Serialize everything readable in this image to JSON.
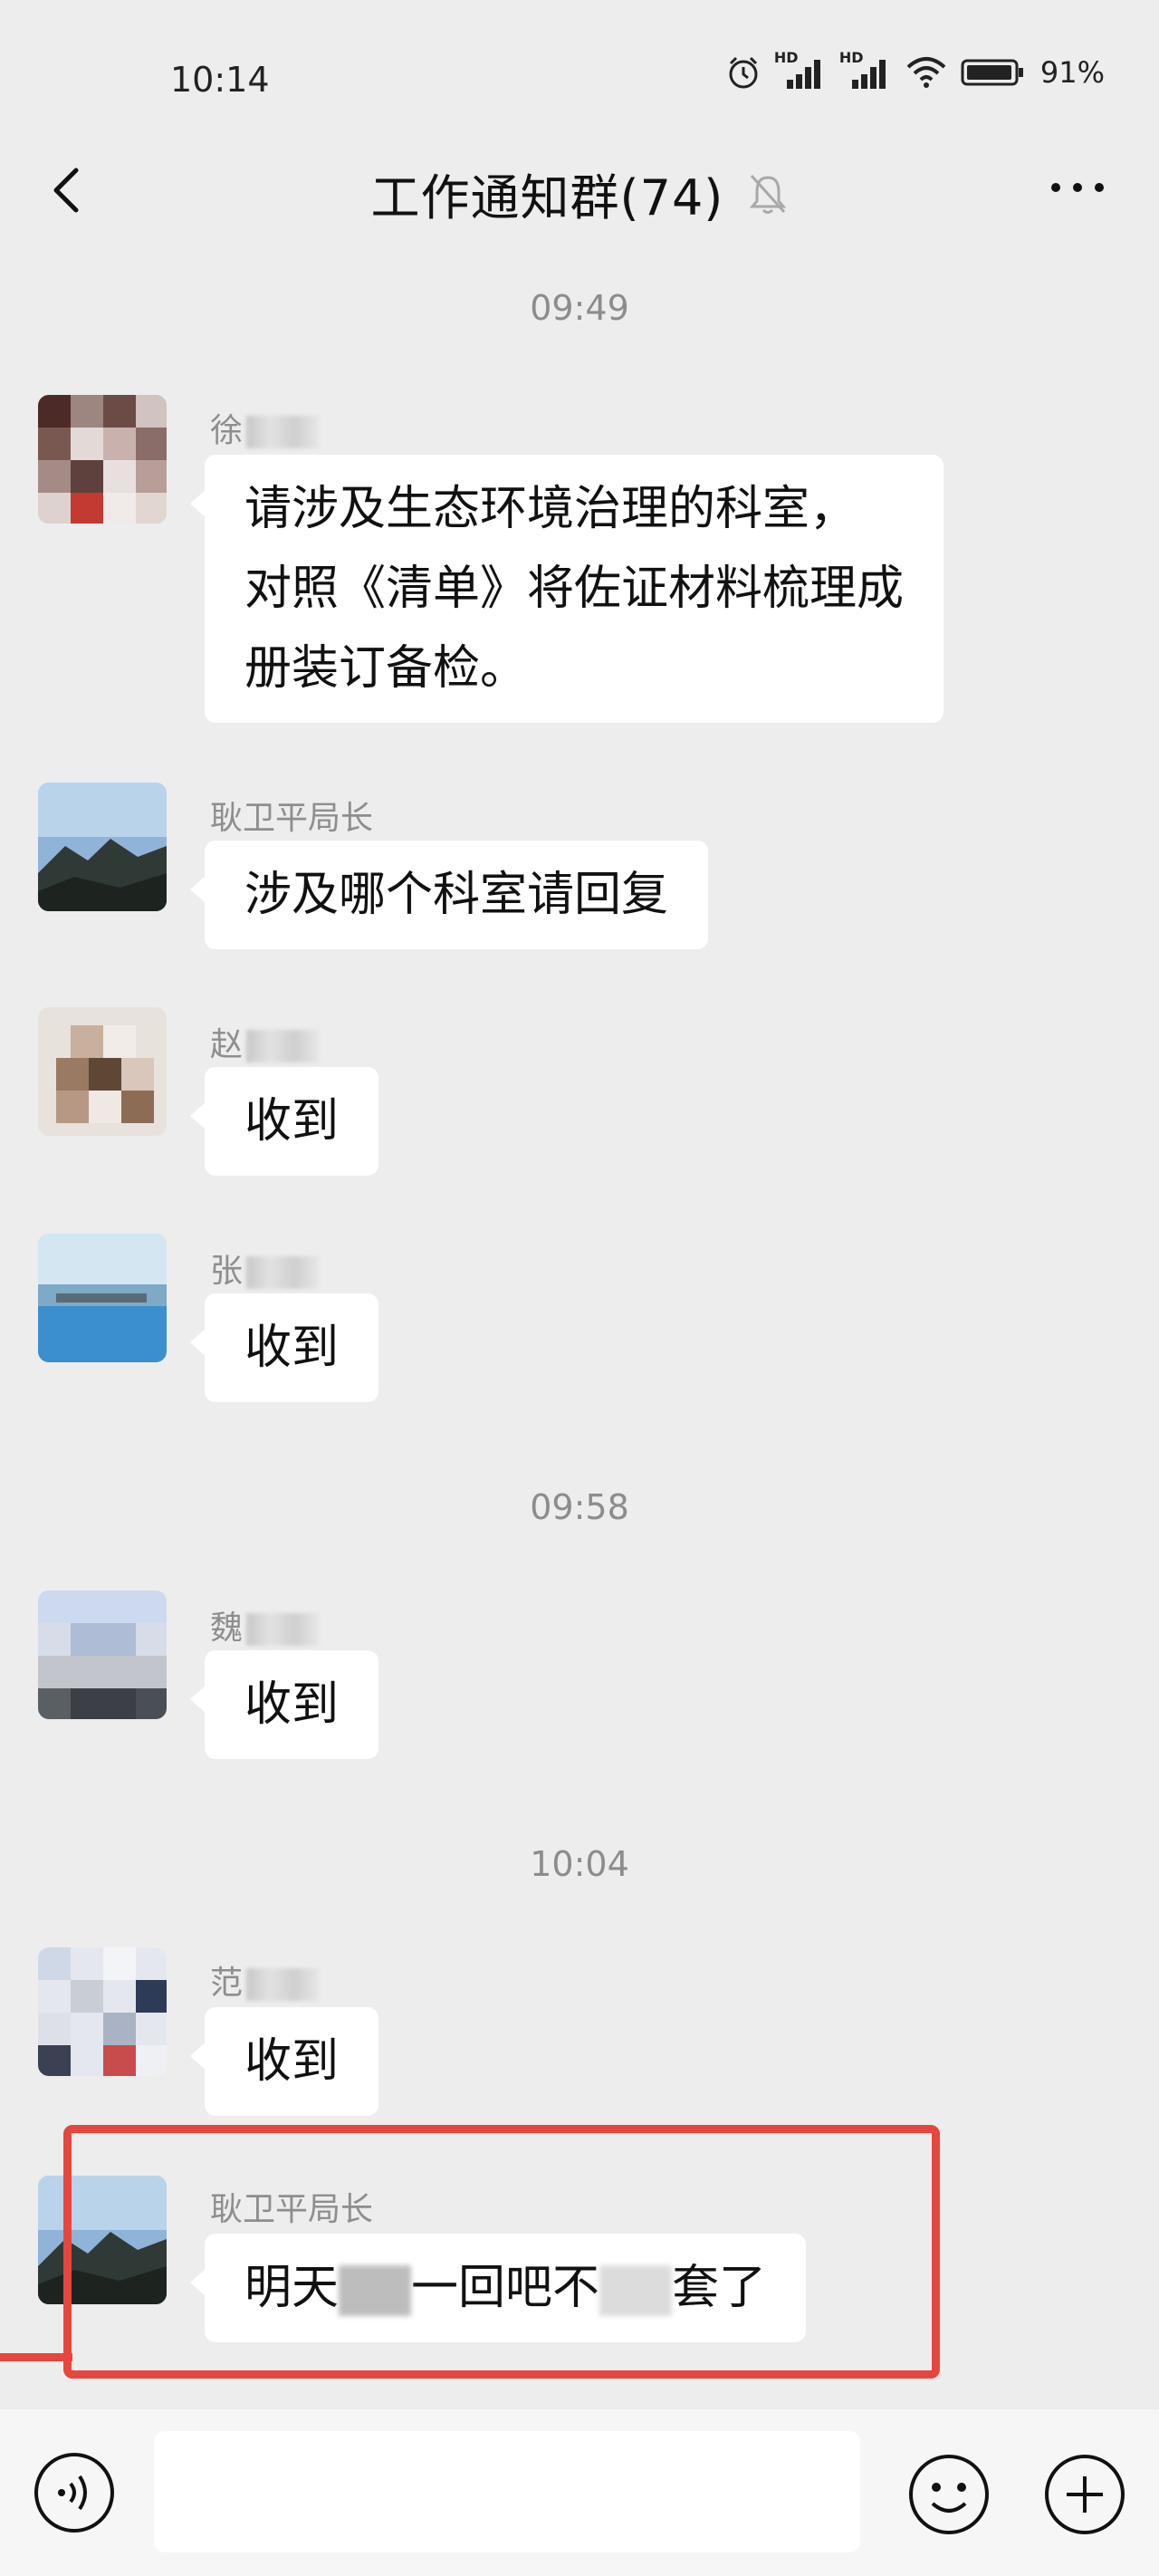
{
  "status_bar": {
    "time": "10:14",
    "battery": "91%",
    "network_badge": "HD"
  },
  "header": {
    "title": "工作通知群(74)",
    "back_icon": "chevron-left-icon",
    "more_icon": "more-dots-icon",
    "mute_icon": "bell-muted-icon"
  },
  "timestamps": [
    "09:49",
    "09:58",
    "10:04"
  ],
  "messages": [
    {
      "sender": "徐",
      "lines": [
        "请涉及生态环境治理的科室，",
        "对照《清单》将佐证材料梳理成",
        "册装订备检。"
      ]
    },
    {
      "sender": "耿卫平局长",
      "lines": [
        "涉及哪个科室请回复"
      ]
    },
    {
      "sender": "赵",
      "lines": [
        "收到"
      ]
    },
    {
      "sender": "张",
      "lines": [
        "收到"
      ]
    },
    {
      "sender": "魏",
      "lines": [
        "收到"
      ]
    },
    {
      "sender": "范",
      "lines": [
        "收到"
      ]
    },
    {
      "sender": "耿卫平局长",
      "parts": [
        "明天",
        "一回吧不",
        "套了"
      ]
    }
  ],
  "input_bar": {
    "placeholder": "",
    "voice_icon": "voice-icon",
    "emoji_icon": "emoji-icon",
    "plus_icon": "plus-icon"
  },
  "colors": {
    "background": "#ededed",
    "bubble": "#ffffff",
    "highlight": "#e6463e",
    "timestamp": "#8c8c8c"
  }
}
